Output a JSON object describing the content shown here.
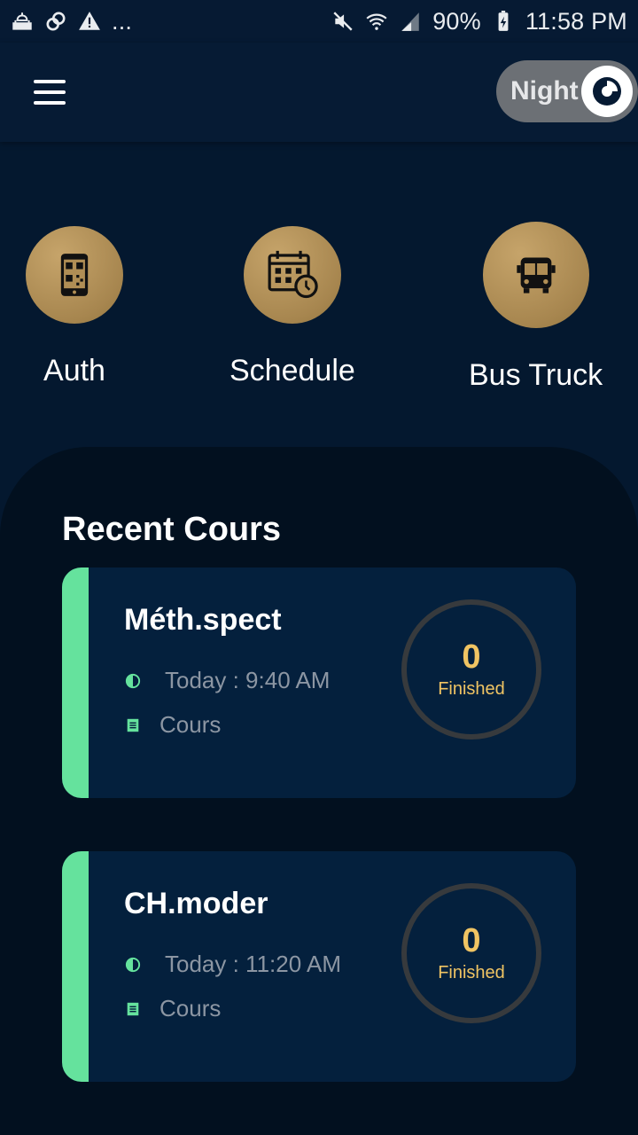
{
  "status_bar": {
    "left_icons": [
      "mosque-icon",
      "link-icon",
      "warning-icon"
    ],
    "more": "...",
    "battery": "90%",
    "time": "11:58 PM"
  },
  "app_bar": {
    "menu_icon": "hamburger-menu-icon",
    "night_toggle": {
      "label": "Night",
      "icon": "eye-icon"
    }
  },
  "shortcuts": [
    {
      "label": "Auth",
      "icon": "qr-phone-icon"
    },
    {
      "label": "Schedule",
      "icon": "calendar-clock-icon"
    },
    {
      "label": "Bus Truck",
      "icon": "bus-icon"
    }
  ],
  "recent": {
    "title": "Recent Cours",
    "courses": [
      {
        "name": "Méth.spect",
        "time": "Today : 9:40 AM",
        "type": "Cours",
        "count": "0",
        "status": "Finished"
      },
      {
        "name": "CH.moder",
        "time": "Today : 11:20 AM",
        "type": "Cours",
        "count": "0",
        "status": "Finished"
      }
    ]
  },
  "colors": {
    "background": "#04182f",
    "panel": "#02101f",
    "card": "#04203d",
    "accent_green": "#65e29d",
    "gold": "#b08e55",
    "count_yellow": "#f0c463"
  }
}
